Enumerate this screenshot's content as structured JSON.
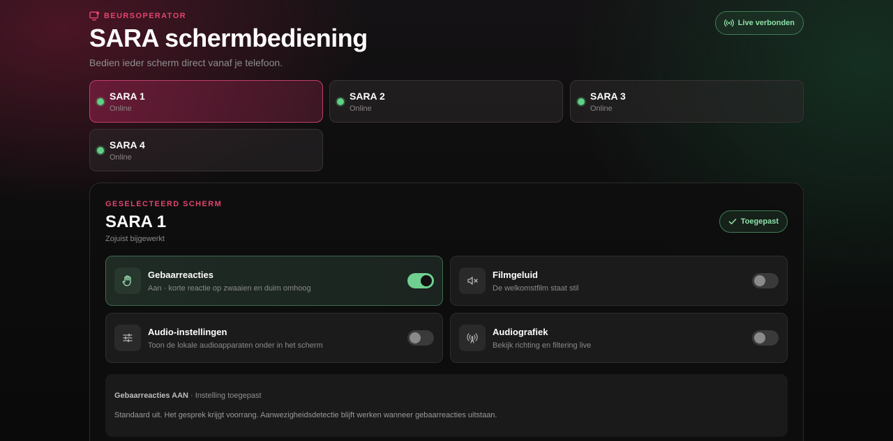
{
  "header": {
    "eyebrow": "BEURSOPERATOR",
    "title": "SARA schermbediening",
    "subtitle": "Bedien ieder scherm direct vanaf je telefoon.",
    "live_status": "Live verbonden"
  },
  "screens": [
    {
      "name": "SARA 1",
      "status": "Online",
      "selected": true
    },
    {
      "name": "SARA 2",
      "status": "Online",
      "selected": false
    },
    {
      "name": "SARA 3",
      "status": "Online",
      "selected": false
    },
    {
      "name": "SARA 4",
      "status": "Online",
      "selected": false
    }
  ],
  "selected": {
    "eyebrow": "GESELECTEERD SCHERM",
    "title": "SARA 1",
    "updated": "Zojuist bijgewerkt",
    "applied_label": "Toegepast"
  },
  "controls": [
    {
      "name": "Gebaarreacties",
      "desc": "Aan · korte reactie op zwaaien en duim omhoog",
      "on": true,
      "icon": "hand-icon"
    },
    {
      "name": "Filmgeluid",
      "desc": "De welkomstfilm staat stil",
      "on": false,
      "icon": "speaker-muted-icon"
    },
    {
      "name": "Audio-instellingen",
      "desc": "Toon de lokale audioapparaten onder in het scherm",
      "on": false,
      "icon": "sliders-icon"
    },
    {
      "name": "Audiografiek",
      "desc": "Bekijk richting en filtering live",
      "on": false,
      "icon": "broadcast-icon"
    }
  ],
  "info": {
    "strong": "Gebaarreacties AAN",
    "rest": " · Instelling toegepast",
    "detail": "Standaard uit. Het gesprek krijgt voorrang. Aanwezigheidsdetectie blijft werken wanneer gebaarreacties uitstaan."
  },
  "colors": {
    "accent": "#e2446e",
    "online": "#5fd184",
    "toggle_on": "#6fd08f"
  }
}
